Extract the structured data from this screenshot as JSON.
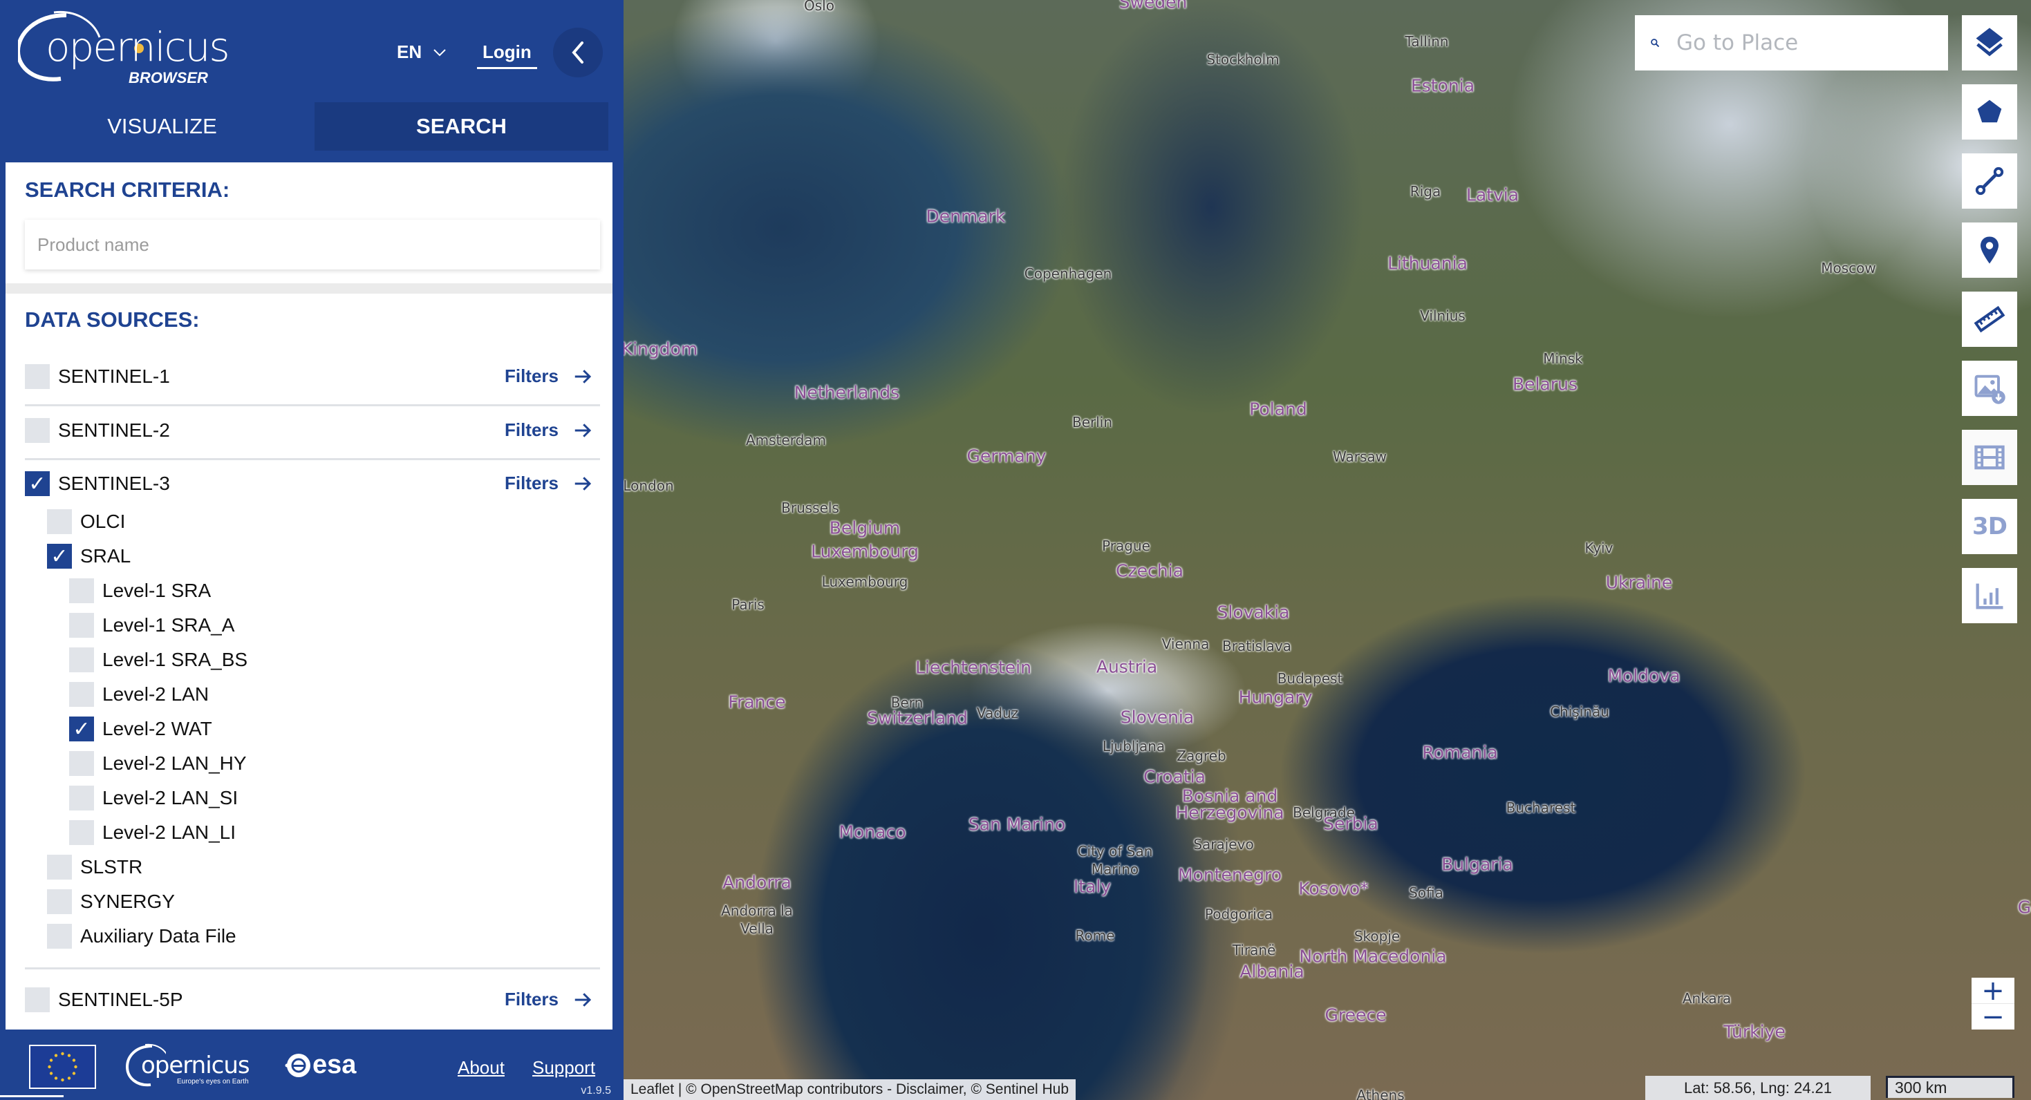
{
  "app": {
    "brand": "opernicus",
    "brand_prefix": "C",
    "subtitle": "BROWSER",
    "language": "EN",
    "login_label": "Login",
    "version": "v1.9.5"
  },
  "tabs": [
    {
      "label": "VISUALIZE",
      "active": false
    },
    {
      "label": "SEARCH",
      "active": true
    }
  ],
  "search_criteria": {
    "heading": "SEARCH CRITERIA:",
    "product_name_placeholder": "Product name",
    "product_name_value": ""
  },
  "data_sources": {
    "heading": "DATA SOURCES:",
    "filters_label": "Filters",
    "items": [
      {
        "label": "SENTINEL-1",
        "checked": false,
        "level": 0,
        "has_filters": true
      },
      {
        "label": "SENTINEL-2",
        "checked": false,
        "level": 0,
        "has_filters": true
      },
      {
        "label": "SENTINEL-3",
        "checked": true,
        "level": 0,
        "has_filters": true
      },
      {
        "label": "OLCI",
        "checked": false,
        "level": 1
      },
      {
        "label": "SRAL",
        "checked": true,
        "level": 1
      },
      {
        "label": "Level-1 SRA",
        "checked": false,
        "level": 2
      },
      {
        "label": "Level-1 SRA_A",
        "checked": false,
        "level": 2
      },
      {
        "label": "Level-1 SRA_BS",
        "checked": false,
        "level": 2
      },
      {
        "label": "Level-2 LAN",
        "checked": false,
        "level": 2
      },
      {
        "label": "Level-2 WAT",
        "checked": true,
        "level": 2
      },
      {
        "label": "Level-2 LAN_HY",
        "checked": false,
        "level": 2
      },
      {
        "label": "Level-2 LAN_SI",
        "checked": false,
        "level": 2
      },
      {
        "label": "Level-2 LAN_LI",
        "checked": false,
        "level": 2
      },
      {
        "label": "SLSTR",
        "checked": false,
        "level": 1
      },
      {
        "label": "SYNERGY",
        "checked": false,
        "level": 1
      },
      {
        "label": "Auxiliary Data File",
        "checked": false,
        "level": 1
      },
      {
        "label": "SENTINEL-5P",
        "checked": false,
        "level": 0,
        "has_filters": true
      }
    ]
  },
  "footer": {
    "copernicus_tagline": "Europe's eyes on Earth",
    "esa_label": "esa",
    "about_label": "About",
    "support_label": "Support"
  },
  "map": {
    "search_placeholder": "Go to Place",
    "search_value": "",
    "tools": [
      {
        "name": "layers-icon",
        "enabled": true
      },
      {
        "name": "polygon-icon",
        "enabled": true
      },
      {
        "name": "line-measure-icon",
        "enabled": true
      },
      {
        "name": "pin-icon",
        "enabled": true
      },
      {
        "name": "ruler-icon",
        "enabled": true
      },
      {
        "name": "image-download-icon",
        "enabled": false
      },
      {
        "name": "film-icon",
        "enabled": false
      },
      {
        "name": "3d-icon",
        "enabled": false,
        "label": "3D"
      },
      {
        "name": "chart-icon",
        "enabled": false
      }
    ],
    "zoom_in_label": "+",
    "zoom_out_label": "−",
    "coordinates": "Lat: 58.56, Lng: 24.21",
    "scale": "300 km",
    "attribution": "Leaflet | © OpenStreetMap contributors - Disclaimer, © Sentinel Hub",
    "labels": [
      {
        "text": "Oslo",
        "type": "city"
      },
      {
        "text": "Sweden",
        "type": "country"
      },
      {
        "text": "Stockholm",
        "type": "city"
      },
      {
        "text": "Tallinn",
        "type": "city"
      },
      {
        "text": "Estonia",
        "type": "country"
      },
      {
        "text": "Riga",
        "type": "city"
      },
      {
        "text": "Latvia",
        "type": "country"
      },
      {
        "text": "Moscow",
        "type": "city"
      },
      {
        "text": "Denmark",
        "type": "country"
      },
      {
        "text": "Copenhagen",
        "type": "city"
      },
      {
        "text": "Lithuania",
        "type": "country"
      },
      {
        "text": "Vilnius",
        "type": "city"
      },
      {
        "text": "Kingdom",
        "type": "country"
      },
      {
        "text": "Minsk",
        "type": "city"
      },
      {
        "text": "Belarus",
        "type": "country"
      },
      {
        "text": "Netherlands",
        "type": "country"
      },
      {
        "text": "Berlin",
        "type": "city"
      },
      {
        "text": "Poland",
        "type": "country"
      },
      {
        "text": "Amsterdam",
        "type": "city"
      },
      {
        "text": "Germany",
        "type": "country"
      },
      {
        "text": "Warsaw",
        "type": "city"
      },
      {
        "text": "London",
        "type": "city"
      },
      {
        "text": "Brussels",
        "type": "city"
      },
      {
        "text": "Belgium",
        "type": "country"
      },
      {
        "text": "Luxembourg",
        "type": "country"
      },
      {
        "text": "Prague",
        "type": "city"
      },
      {
        "text": "Luxembourg",
        "type": "city"
      },
      {
        "text": "Czechia",
        "type": "country"
      },
      {
        "text": "Kyiv",
        "type": "city"
      },
      {
        "text": "Ukraine",
        "type": "country"
      },
      {
        "text": "Paris",
        "type": "city"
      },
      {
        "text": "Slovakia",
        "type": "country"
      },
      {
        "text": "Vienna",
        "type": "city"
      },
      {
        "text": "Bratislava",
        "type": "city"
      },
      {
        "text": "Liechtenstein",
        "type": "country"
      },
      {
        "text": "Austria",
        "type": "country"
      },
      {
        "text": "Budapest",
        "type": "city"
      },
      {
        "text": "Moldova",
        "type": "country"
      },
      {
        "text": "Bern",
        "type": "city"
      },
      {
        "text": "Vaduz",
        "type": "city"
      },
      {
        "text": "Hungary",
        "type": "country"
      },
      {
        "text": "France",
        "type": "country"
      },
      {
        "text": "Chişinău",
        "type": "city"
      },
      {
        "text": "Switzerland",
        "type": "country"
      },
      {
        "text": "Slovenia",
        "type": "country"
      },
      {
        "text": "Ljubljana",
        "type": "city"
      },
      {
        "text": "Romania",
        "type": "country"
      },
      {
        "text": "Zagreb",
        "type": "city"
      },
      {
        "text": "Croatia",
        "type": "country"
      },
      {
        "text": "Bosnia and",
        "type": "country"
      },
      {
        "text": "Herzegovina",
        "type": "country"
      },
      {
        "text": "Belgrade",
        "type": "city"
      },
      {
        "text": "Bucharest",
        "type": "city"
      },
      {
        "text": "Monaco",
        "type": "country"
      },
      {
        "text": "San Marino",
        "type": "country"
      },
      {
        "text": "Serbia",
        "type": "country"
      },
      {
        "text": "Sarajevo",
        "type": "city"
      },
      {
        "text": "City of San",
        "type": "city"
      },
      {
        "text": "Marino",
        "type": "city"
      },
      {
        "text": "Bulgaria",
        "type": "country"
      },
      {
        "text": "Montenegro",
        "type": "country"
      },
      {
        "text": "Kosovo*",
        "type": "country"
      },
      {
        "text": "Andorra",
        "type": "country"
      },
      {
        "text": "Italy",
        "type": "country"
      },
      {
        "text": "Sofia",
        "type": "city"
      },
      {
        "text": "Andorra la",
        "type": "city"
      },
      {
        "text": "Vella",
        "type": "city"
      },
      {
        "text": "Podgorica",
        "type": "city"
      },
      {
        "text": "Skopje",
        "type": "city"
      },
      {
        "text": "Rome",
        "type": "city"
      },
      {
        "text": "Tiranë",
        "type": "city"
      },
      {
        "text": "North Macedonia",
        "type": "country"
      },
      {
        "text": "Albania",
        "type": "country"
      },
      {
        "text": "Ankara",
        "type": "city"
      },
      {
        "text": "Greece",
        "type": "country"
      },
      {
        "text": "Türkiye",
        "type": "country"
      },
      {
        "text": "Athens",
        "type": "city"
      },
      {
        "text": "Ge",
        "type": "country"
      }
    ]
  }
}
